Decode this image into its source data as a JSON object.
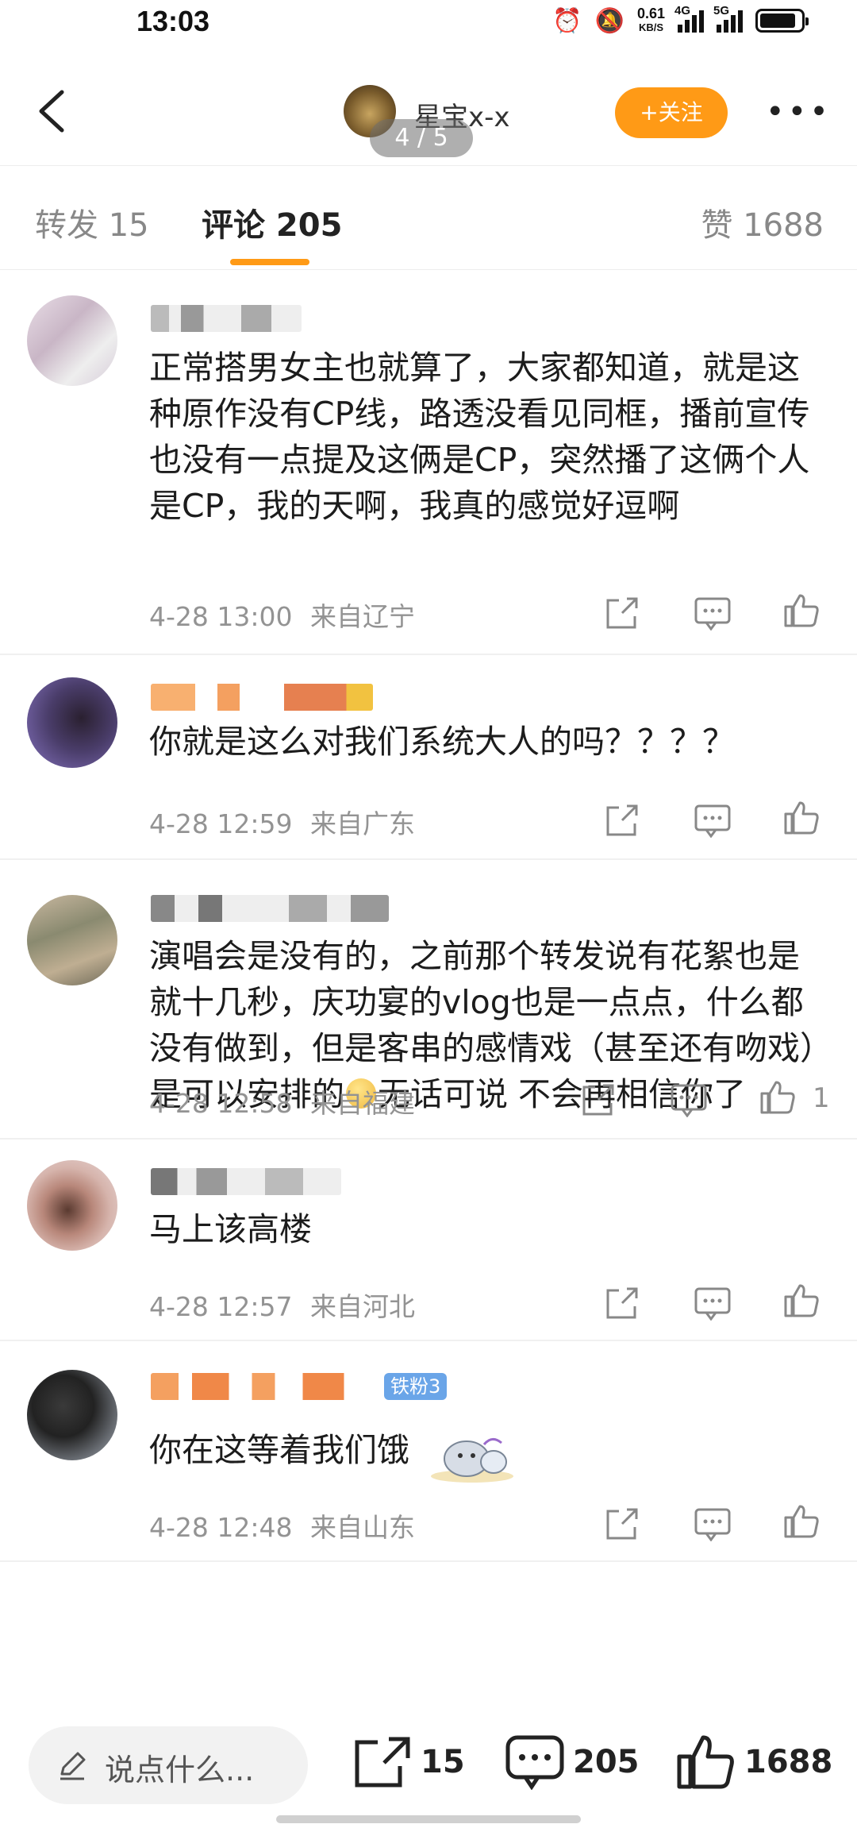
{
  "status_bar": {
    "time": "13:03",
    "net_speed": "0.61",
    "net_unit": "KB/S",
    "sim1_label": "4G",
    "sim2_label": "5G"
  },
  "header": {
    "username": "星宝x-x",
    "follow_label": "+关注",
    "page_indicator": "4 / 5",
    "more_icon": "more-dots-icon"
  },
  "tabs": {
    "repost": "转发 15",
    "comments": "评论 205",
    "likes": "赞 1688"
  },
  "comments": [
    {
      "text": "正常搭男女主也就算了，大家都知道，就是这种原作没有CP线，路透没看见同框，播前宣传也没有一点提及这俩是CP，突然播了这俩个人是CP，我的天啊，我真的感觉好逗啊",
      "time": "4-28 13:00",
      "location": "来自辽宁",
      "likes": ""
    },
    {
      "text": "你就是这么对我们系统大人的吗？？？？",
      "time": "4-28 12:59",
      "location": "来自广东",
      "likes": ""
    },
    {
      "text_before": "演唱会是没有的，之前那个转发说有花絮也是就十几秒，庆功宴的vlog也是一点点，什么都没有做到，但是客串的感情戏（甚至还有吻戏）是可以安排的",
      "text_after": "无话可说 不会再相信你了",
      "time": "4-28 12:58",
      "location": "来自福建",
      "likes": "1"
    },
    {
      "text": "马上该高楼",
      "time": "4-28 12:57",
      "location": "来自河北",
      "likes": ""
    },
    {
      "text": "你在这等着我们饿",
      "badge": "铁粉3",
      "time": "4-28 12:48",
      "location": "来自山东",
      "likes": ""
    }
  ],
  "bottom_bar": {
    "input_placeholder": "说点什么...",
    "repost_count": "15",
    "comment_count": "205",
    "like_count": "1688"
  },
  "colors": {
    "accent": "#ff9a16",
    "muted_text": "#939393"
  }
}
